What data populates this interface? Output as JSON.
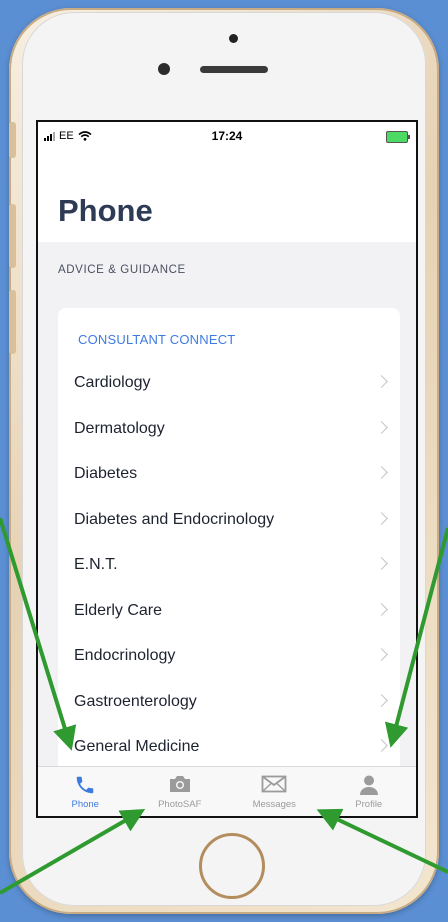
{
  "status_bar": {
    "carrier": "EE",
    "time": "17:24"
  },
  "page": {
    "title": "Phone",
    "section_label": "ADVICE & GUIDANCE"
  },
  "card": {
    "heading": "CONSULTANT CONNECT",
    "items": [
      {
        "label": "Cardiology"
      },
      {
        "label": "Dermatology"
      },
      {
        "label": "Diabetes"
      },
      {
        "label": "Diabetes and Endocrinology"
      },
      {
        "label": "E.N.T."
      },
      {
        "label": "Elderly Care"
      },
      {
        "label": "Endocrinology"
      },
      {
        "label": "Gastroenterology"
      },
      {
        "label": "General Medicine"
      }
    ]
  },
  "tab_bar": {
    "tabs": [
      {
        "label": "Phone",
        "icon": "phone-icon",
        "active": true
      },
      {
        "label": "PhotoSAF",
        "icon": "camera-icon",
        "active": false
      },
      {
        "label": "Messages",
        "icon": "envelope-icon",
        "active": false
      },
      {
        "label": "Profile",
        "icon": "person-icon",
        "active": false
      }
    ]
  },
  "colors": {
    "background": "#5b8fd3",
    "accent": "#3e7be0",
    "arrow": "#2f9a2f",
    "title": "#2e3b55"
  }
}
